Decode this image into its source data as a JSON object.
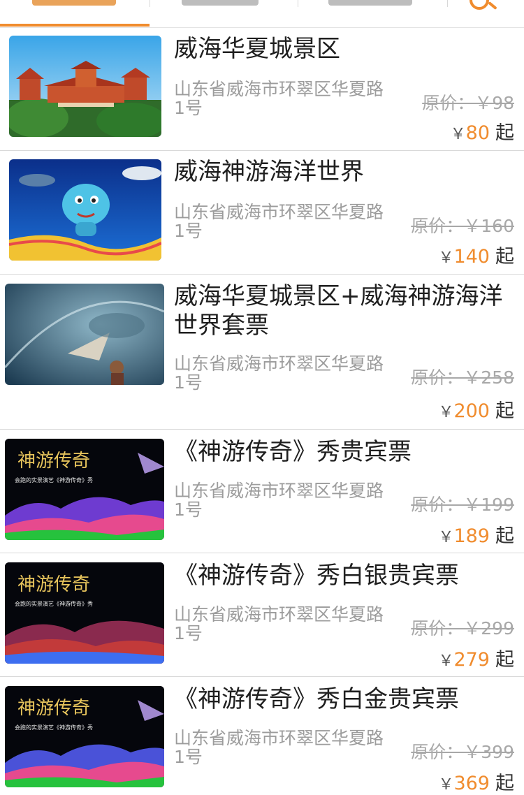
{
  "tabs": [
    {
      "label": ""
    },
    {
      "label": ""
    },
    {
      "label": ""
    }
  ],
  "search": {
    "icon": "search-icon"
  },
  "colors": {
    "accent": "#f08c2e",
    "text": "#1f1f1f",
    "muted": "#9c9c9c",
    "divider": "#d9d9d9"
  },
  "items": [
    {
      "title": "威海华夏城景区",
      "address": "山东省威海市环翠区华夏路1号",
      "original_price": "原价：￥98",
      "currency": "￥",
      "price": "80",
      "suffix": "起"
    },
    {
      "title": "威海神游海洋世界",
      "address": "山东省威海市环翠区华夏路1号",
      "original_price": "原价：￥160",
      "currency": "￥",
      "price": "140",
      "suffix": "起"
    },
    {
      "title": "威海华夏城景区+威海神游海洋世界套票",
      "address": "山东省威海市环翠区华夏路1号",
      "original_price": "原价：￥258",
      "currency": "￥",
      "price": "200",
      "suffix": "起"
    },
    {
      "title": "《神游传奇》秀贵宾票",
      "address": "山东省威海市环翠区华夏路1号",
      "original_price": "原价：￥199",
      "currency": "￥",
      "price": "189",
      "suffix": "起",
      "thumb_logo": "神游传奇",
      "thumb_sub": "会跑的实景演艺《神游传奇》秀"
    },
    {
      "title": "《神游传奇》秀白银贵宾票",
      "address": "山东省威海市环翠区华夏路1号",
      "original_price": "原价：￥299",
      "currency": "￥",
      "price": "279",
      "suffix": "起",
      "thumb_logo": "神游传奇",
      "thumb_sub": "会跑的实景演艺《神游传奇》秀"
    },
    {
      "title": "《神游传奇》秀白金贵宾票",
      "address": "山东省威海市环翠区华夏路1号",
      "original_price": "原价：￥399",
      "currency": "￥",
      "price": "369",
      "suffix": "起",
      "thumb_logo": "神游传奇",
      "thumb_sub": "会跑的实景演艺《神游传奇》秀"
    }
  ]
}
